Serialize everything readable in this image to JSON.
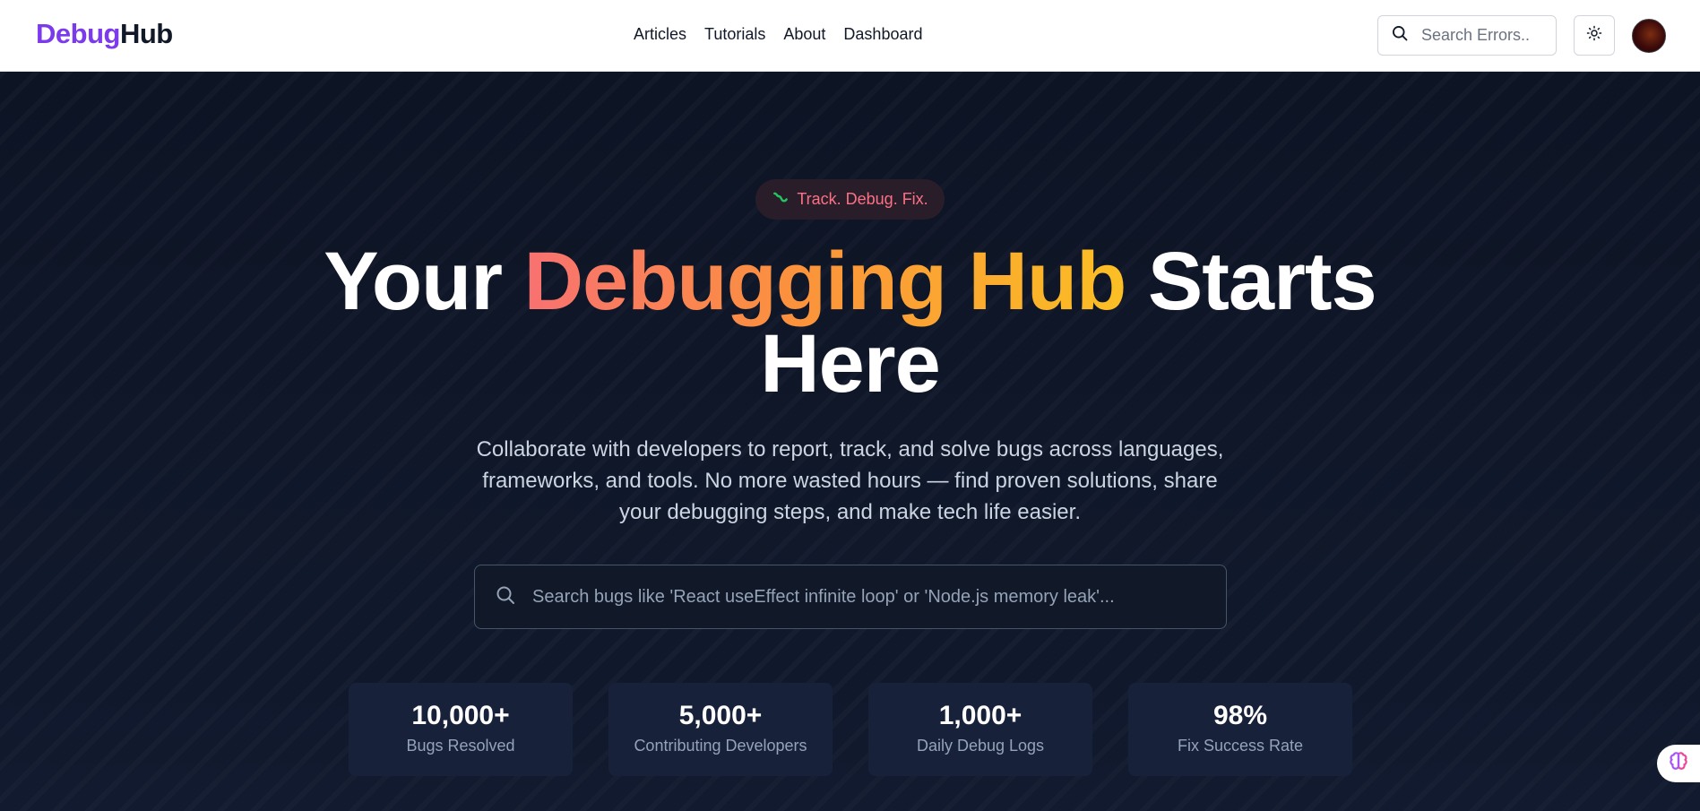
{
  "brand": {
    "part1": "Debug",
    "part2": "Hub"
  },
  "nav": {
    "items": [
      "Articles",
      "Tutorials",
      "About",
      "Dashboard"
    ]
  },
  "top_search": {
    "placeholder": "Search Errors.."
  },
  "icons": {
    "search": "search-icon",
    "theme": "sun-icon",
    "avatar": "avatar",
    "badge": "bug-icon",
    "assistant": "brain-icon"
  },
  "hero": {
    "badge": "Track. Debug. Fix.",
    "title_pre": "Your",
    "title_grad": "Debugging Hub",
    "title_post": "Starts",
    "title_line2": "Here",
    "subtitle": "Collaborate with developers to report, track, and solve bugs across languages, frameworks, and tools. No more wasted hours — find proven solutions, share your debugging steps, and make tech life easier.",
    "search_placeholder": "Search bugs like 'React useEffect infinite loop' or 'Node.js memory leak'..."
  },
  "stats": [
    {
      "value": "10,000+",
      "label": "Bugs Resolved"
    },
    {
      "value": "5,000+",
      "label": "Contributing Developers"
    },
    {
      "value": "1,000+",
      "label": "Daily Debug Logs"
    },
    {
      "value": "98%",
      "label": "Fix Success Rate"
    }
  ],
  "colors": {
    "brand_purple": "#7c3aed",
    "hero_bg": "#0f1628",
    "gradient_start": "#f87171",
    "gradient_end": "#fbbf24",
    "badge_text": "#fb7185"
  }
}
